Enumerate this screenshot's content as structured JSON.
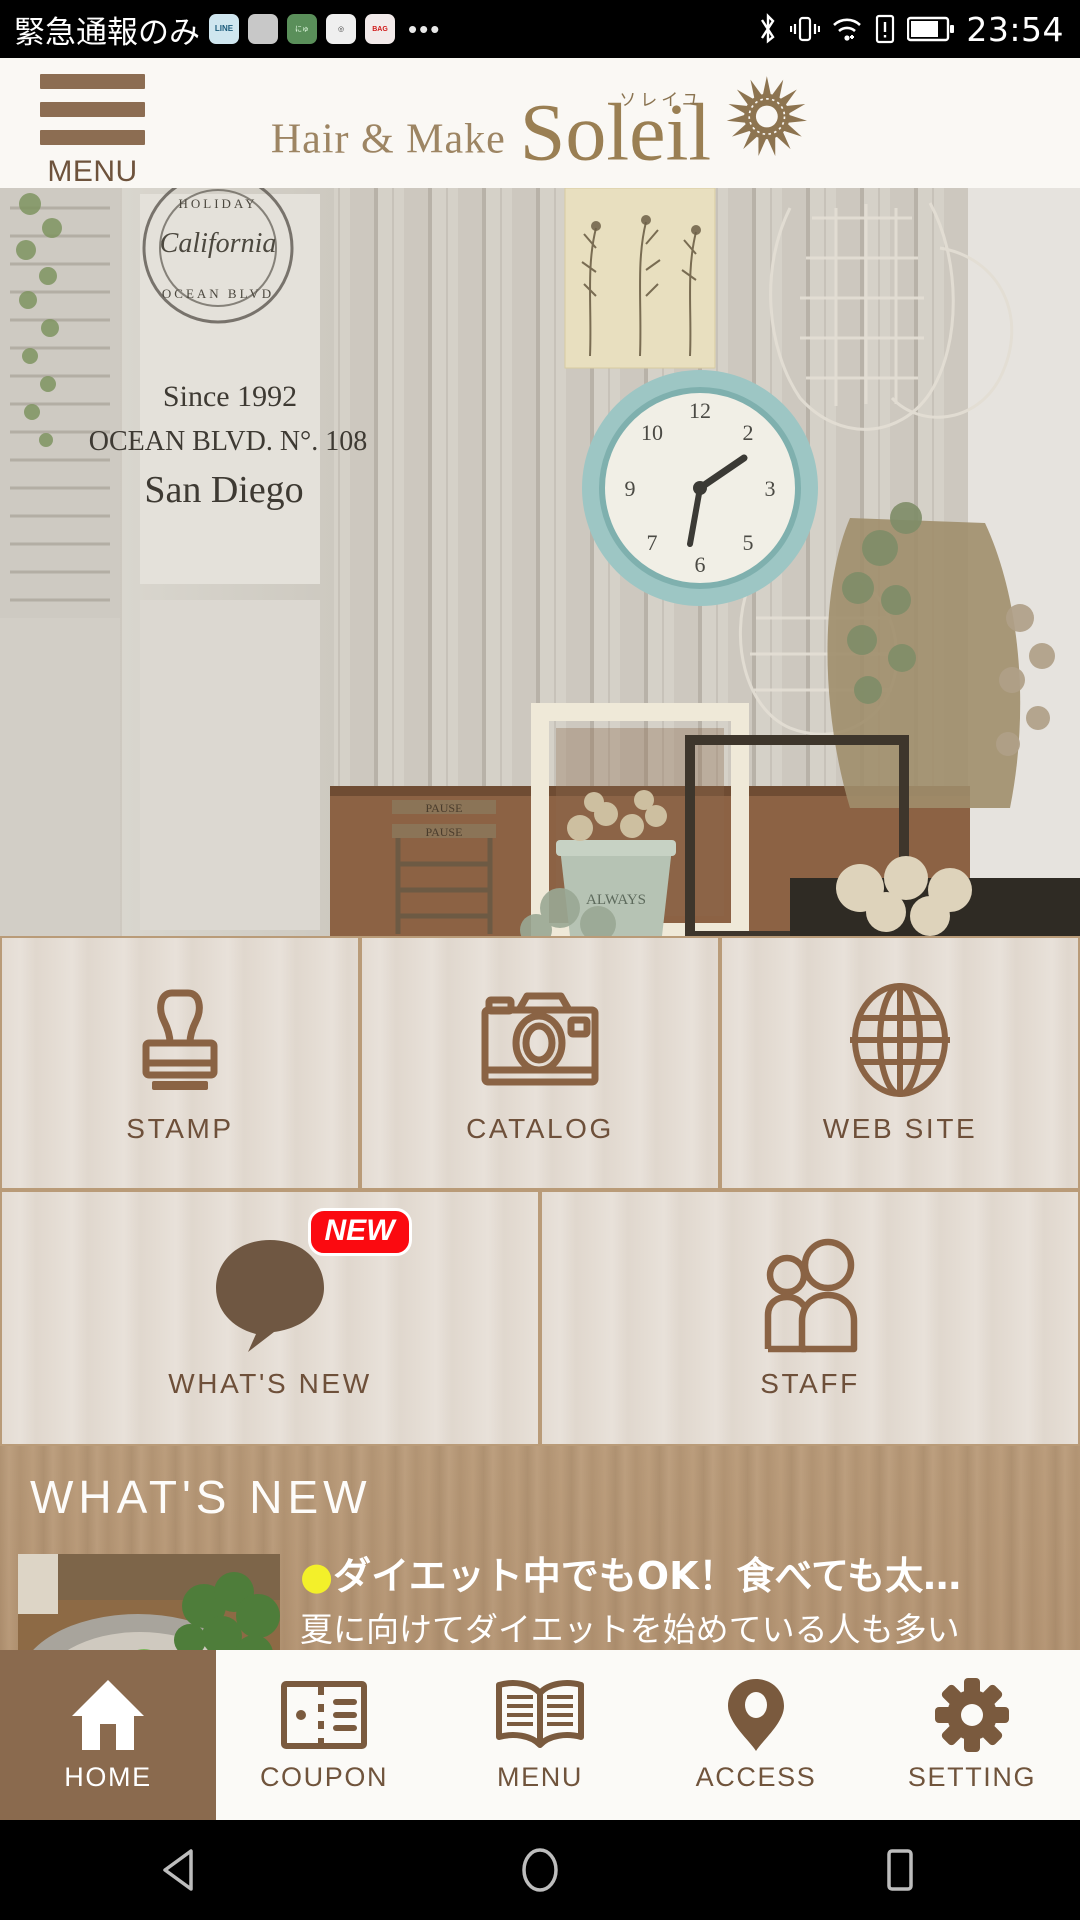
{
  "status_bar": {
    "carrier": "緊急通報のみ",
    "clock": "23:54",
    "overflow": "•••",
    "notif_icons": [
      {
        "name": "line-app-icon",
        "text": "LINE"
      },
      {
        "name": "grey-app-icon",
        "text": ""
      },
      {
        "name": "green-app-icon",
        "text": "にゅ"
      },
      {
        "name": "white-circle-app-icon",
        "text": "◎"
      },
      {
        "name": "red-text-app-icon",
        "text": "BAG"
      }
    ],
    "right_icons": [
      "bluetooth-icon",
      "vibrate-icon",
      "wifi-icon",
      "sim-alert-icon",
      "battery-icon"
    ]
  },
  "header": {
    "menu_label": "MENU",
    "logo_prefix": "Hair & Make",
    "logo_name": "Soleil",
    "logo_ruby": "ソレイユ",
    "logo_mark": "sunflower-icon"
  },
  "hero": {
    "alt": "salon-interior-photo",
    "sign_california": "California",
    "sign_since": "Since 1992",
    "sign_street": "OCEAN BLVD. N°. 108",
    "sign_city": "San Diego",
    "chair_label": "PAUSE"
  },
  "tiles": {
    "row1": [
      {
        "label": "STAMP",
        "icon": "stamp-icon",
        "name": "tile-stamp"
      },
      {
        "label": "CATALOG",
        "icon": "camera-icon",
        "name": "tile-catalog"
      },
      {
        "label": "WEB SITE",
        "icon": "globe-icon",
        "name": "tile-web-site"
      }
    ],
    "row2": [
      {
        "label": "WHAT'S NEW",
        "icon": "speech-bubble-icon",
        "name": "tile-whats-new",
        "badge": "NEW"
      },
      {
        "label": "STAFF",
        "icon": "people-icon",
        "name": "tile-staff",
        "badge": ""
      }
    ]
  },
  "whats_new": {
    "section_title": "WHAT'S NEW",
    "arrow": "›",
    "items": [
      {
        "dot": "●",
        "headline": "ダイエット中でもOK！食べても太…",
        "body": "夏に向けてダイエットを始めている人も多い はず…",
        "thumb": "food-photo-thumbnail"
      }
    ]
  },
  "tabbar": {
    "tabs": [
      {
        "label": "HOME",
        "icon": "home-icon",
        "active": true
      },
      {
        "label": "COUPON",
        "icon": "ticket-icon",
        "active": false
      },
      {
        "label": "MENU",
        "icon": "book-icon",
        "active": false
      },
      {
        "label": "ACCESS",
        "icon": "map-pin-icon",
        "active": false
      },
      {
        "label": "SETTING",
        "icon": "gear-icon",
        "active": false
      }
    ]
  },
  "navbar": {
    "back": "back-triangle-icon",
    "home": "home-circle-icon",
    "recents": "recents-square-icon"
  },
  "colors": {
    "brand_brown": "#8a6a4e",
    "tile_bg": "#e4dcd3",
    "tile_border": "#b99b78",
    "wood_bg": "#b99a78",
    "badge_red": "#fb0a10",
    "header_bg": "#faf8f4"
  }
}
